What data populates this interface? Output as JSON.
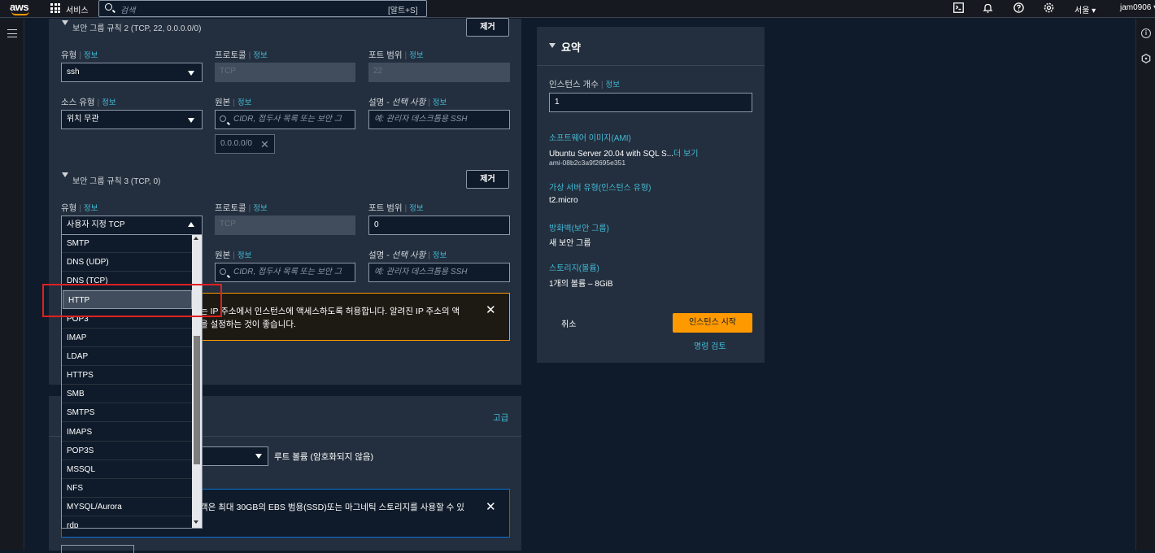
{
  "header": {
    "logo": "aws",
    "services": "서비스",
    "search_placeholder": "검색",
    "search_shortcut": "[알트+S]",
    "region": "서울 ▾",
    "account": "jam0906 ▾"
  },
  "rule2": {
    "title": "보안 그룹 규칙 2 (TCP, 22, 0.0.0.0/0)",
    "remove": "제거",
    "type_label": "유형",
    "type_value": "ssh",
    "protocol_label": "프로토콜",
    "protocol_value": "TCP",
    "port_label": "포트 범위",
    "port_value": "22",
    "source_type_label": "소스 유형",
    "source_type_value": "위치 무관",
    "source_label": "원본",
    "source_placeholder": "CIDR, 접두사 목록 또는 보안 그",
    "source_token": "0.0.0.0/0",
    "desc_label": "설명 - ",
    "desc_label_optional": "선택 사항",
    "desc_placeholder": "예: 관리자 데스크톱용 SSH"
  },
  "rule3": {
    "title": "보안 그룹 규칙 3 (TCP, 0)",
    "remove": "제거",
    "type_label": "유형",
    "type_value": "사용자 지정 TCP",
    "protocol_label": "프로토콜",
    "protocol_value": "TCP",
    "port_label": "포트 범위",
    "port_value": "0",
    "source_label": "원본",
    "source_placeholder": "CIDR, 접두사 목록 또는 보안 그",
    "desc_label": "설명 - ",
    "desc_label_optional": "선택 사항",
    "desc_placeholder": "예: 관리자 데스크톱용 SSH"
  },
  "info_link": "정보",
  "warning": {
    "line1": "는 IP 주소에서 인스턴스에 액세스하도록 허용합니다. 알려진 IP 주소의 액",
    "line2": "을 설정하는 것이 좋습니다."
  },
  "dropdown_options": [
    "SMTP",
    "DNS (UDP)",
    "DNS (TCP)",
    "HTTP",
    "POP3",
    "IMAP",
    "LDAP",
    "HTTPS",
    "SMB",
    "SMTPS",
    "IMAPS",
    "POP3S",
    "MSSQL",
    "NFS",
    "MYSQL/Aurora",
    "rdp"
  ],
  "dropdown_selected": "HTTP",
  "storage": {
    "advanced": "고급",
    "root_volume": "루트 볼륨  (암호화되지 않음)",
    "free_tier_note": "객은 최대 30GB의 EBS 범용(SSD)또는 마그네틱 스토리지를 사용할 수 있"
  },
  "summary": {
    "title": "요약",
    "instance_count_label": "인스턴스 개수",
    "instance_count_value": "1",
    "ami_label": "소프트웨어 이미지(AMI)",
    "ami_value": "Ubuntu Server 20.04 with SQL S...",
    "ami_more": "더 보기",
    "ami_id": "ami-08b2c3a9f2695e351",
    "instance_type_label": "가상 서버 유형(인스턴스 유형)",
    "instance_type_value": "t2.micro",
    "firewall_label": "방화벽(보안 그룹)",
    "firewall_value": "새 보안 그룹",
    "storage_label": "스토리지(볼륨)",
    "storage_value": "1개의 볼륨 – 8GiB",
    "cancel": "취소",
    "launch": "인스턴스 시작",
    "review_commands": "명령 검토"
  },
  "colors": {
    "accent": "#ff9900",
    "link": "#44b9d6",
    "highlight": "#e02020"
  }
}
